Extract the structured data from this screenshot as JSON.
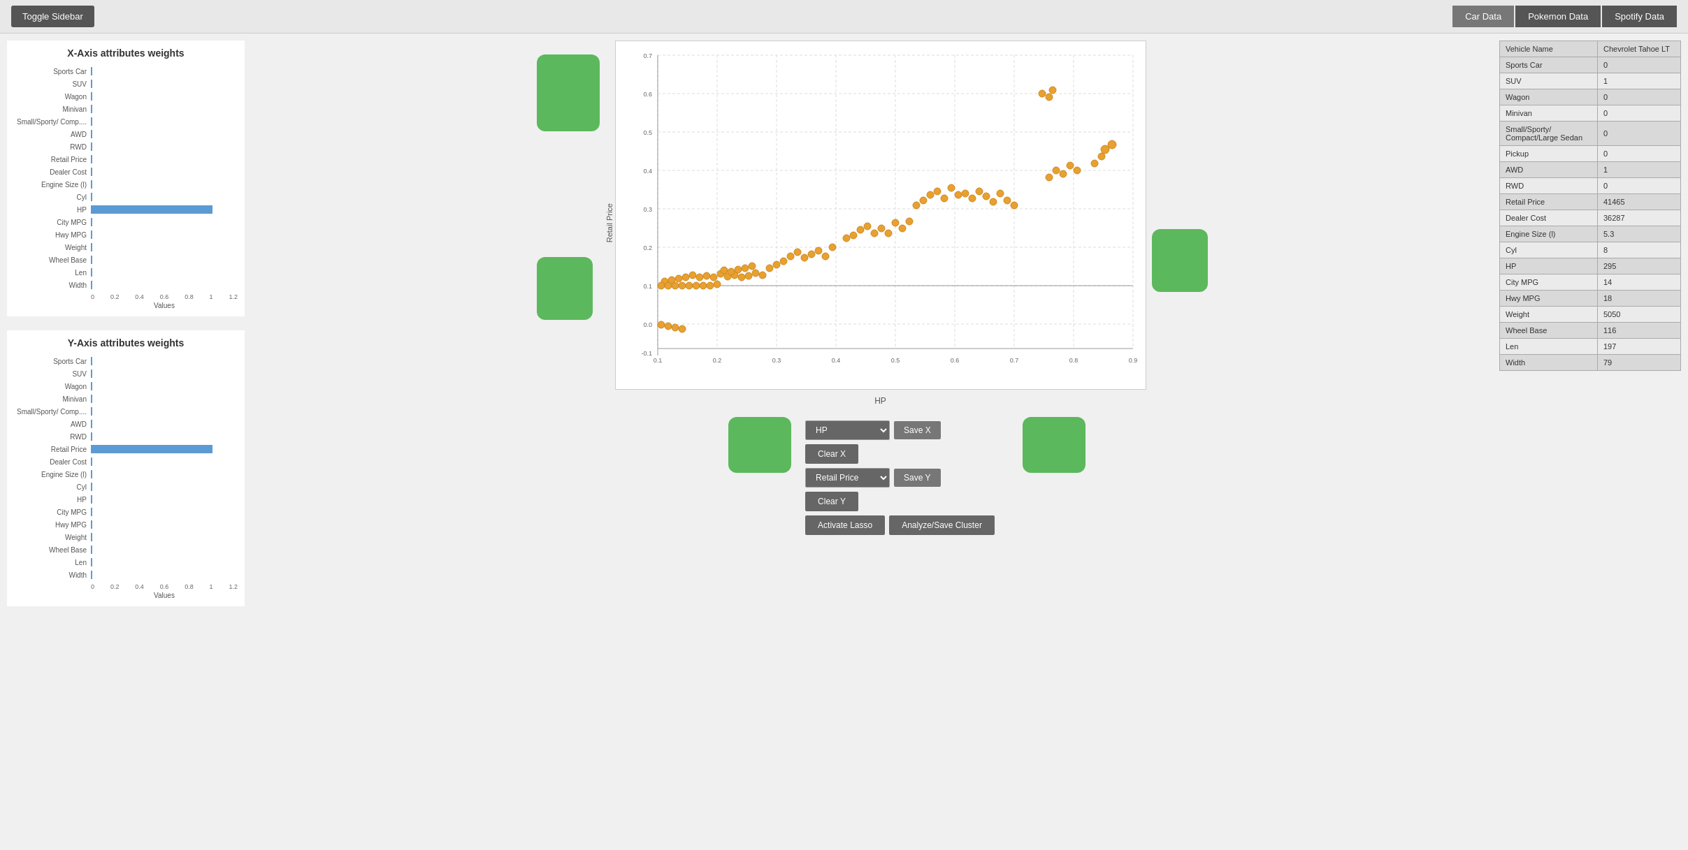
{
  "header": {
    "toggle_label": "Toggle Sidebar",
    "tabs": [
      {
        "label": "Car Data",
        "active": true
      },
      {
        "label": "Pokemon Data",
        "active": false
      },
      {
        "label": "Spotify Data",
        "active": false
      }
    ]
  },
  "x_axis_chart": {
    "title": "X-Axis attributes weights",
    "x_label": "Values",
    "x_ticks": [
      "0",
      "0.2",
      "0.4",
      "0.6",
      "0.8",
      "1",
      "1.2"
    ],
    "bars": [
      {
        "label": "Sports Car",
        "value": 0.02
      },
      {
        "label": "SUV",
        "value": 0.02
      },
      {
        "label": "Wagon",
        "value": 0.02
      },
      {
        "label": "Minivan",
        "value": 0.02
      },
      {
        "label": "Small/Sporty/ Comp....",
        "value": 0.02
      },
      {
        "label": "AWD",
        "value": 0.02
      },
      {
        "label": "RWD",
        "value": 0.02
      },
      {
        "label": "Retail Price",
        "value": 0.02
      },
      {
        "label": "Dealer Cost",
        "value": 0.02
      },
      {
        "label": "Engine Size (l)",
        "value": 0.02
      },
      {
        "label": "Cyl",
        "value": 0.02
      },
      {
        "label": "HP",
        "value": 1.0
      },
      {
        "label": "City MPG",
        "value": 0.02
      },
      {
        "label": "Hwy MPG",
        "value": 0.02
      },
      {
        "label": "Weight",
        "value": 0.02
      },
      {
        "label": "Wheel Base",
        "value": 0.02
      },
      {
        "label": "Len",
        "value": 0.02
      },
      {
        "label": "Width",
        "value": 0.02
      }
    ]
  },
  "y_axis_chart": {
    "title": "Y-Axis attributes weights",
    "x_label": "Values",
    "x_ticks": [
      "0",
      "0.2",
      "0.4",
      "0.6",
      "0.8",
      "1",
      "1.2"
    ],
    "bars": [
      {
        "label": "Sports Car",
        "value": 0.02
      },
      {
        "label": "SUV",
        "value": 0.02
      },
      {
        "label": "Wagon",
        "value": 0.02
      },
      {
        "label": "Minivan",
        "value": 0.02
      },
      {
        "label": "Small/Sporty/ Comp....",
        "value": 0.02
      },
      {
        "label": "AWD",
        "value": 0.02
      },
      {
        "label": "RWD",
        "value": 0.02
      },
      {
        "label": "Retail Price",
        "value": 1.0
      },
      {
        "label": "Dealer Cost",
        "value": 0.02
      },
      {
        "label": "Engine Size (l)",
        "value": 0.02
      },
      {
        "label": "Cyl",
        "value": 0.02
      },
      {
        "label": "HP",
        "value": 0.02
      },
      {
        "label": "City MPG",
        "value": 0.02
      },
      {
        "label": "Hwy MPG",
        "value": 0.02
      },
      {
        "label": "Weight",
        "value": 0.02
      },
      {
        "label": "Wheel Base",
        "value": 0.02
      },
      {
        "label": "Len",
        "value": 0.02
      },
      {
        "label": "Width",
        "value": 0.02
      }
    ]
  },
  "scatter": {
    "x_label": "HP",
    "y_label": "Retail Price"
  },
  "controls": {
    "x_select_value": "HP",
    "y_select_value": "Retail Price",
    "save_x_label": "Save X",
    "clear_x_label": "Clear X",
    "save_y_label": "Save Y",
    "clear_y_label": "Clear Y",
    "activate_lasso_label": "Activate Lasso",
    "analyze_save_label": "Analyze/Save Cluster"
  },
  "table": {
    "col1": "Vehicle Name",
    "col2": "Chevrolet Tahoe LT",
    "rows": [
      {
        "attr": "Sports Car",
        "val": "0"
      },
      {
        "attr": "SUV",
        "val": "1"
      },
      {
        "attr": "Wagon",
        "val": "0"
      },
      {
        "attr": "Minivan",
        "val": "0"
      },
      {
        "attr": "Small/Sporty/ Compact/Large Sedan",
        "val": "0"
      },
      {
        "attr": "Pickup",
        "val": "0"
      },
      {
        "attr": "AWD",
        "val": "1"
      },
      {
        "attr": "RWD",
        "val": "0"
      },
      {
        "attr": "Retail Price",
        "val": "41465"
      },
      {
        "attr": "Dealer Cost",
        "val": "36287"
      },
      {
        "attr": "Engine Size (l)",
        "val": "5.3"
      },
      {
        "attr": "Cyl",
        "val": "8"
      },
      {
        "attr": "HP",
        "val": "295"
      },
      {
        "attr": "City MPG",
        "val": "14"
      },
      {
        "attr": "Hwy MPG",
        "val": "18"
      },
      {
        "attr": "Weight",
        "val": "5050"
      },
      {
        "attr": "Wheel Base",
        "val": "116"
      },
      {
        "attr": "Len",
        "val": "197"
      },
      {
        "attr": "Width",
        "val": "79"
      }
    ]
  }
}
